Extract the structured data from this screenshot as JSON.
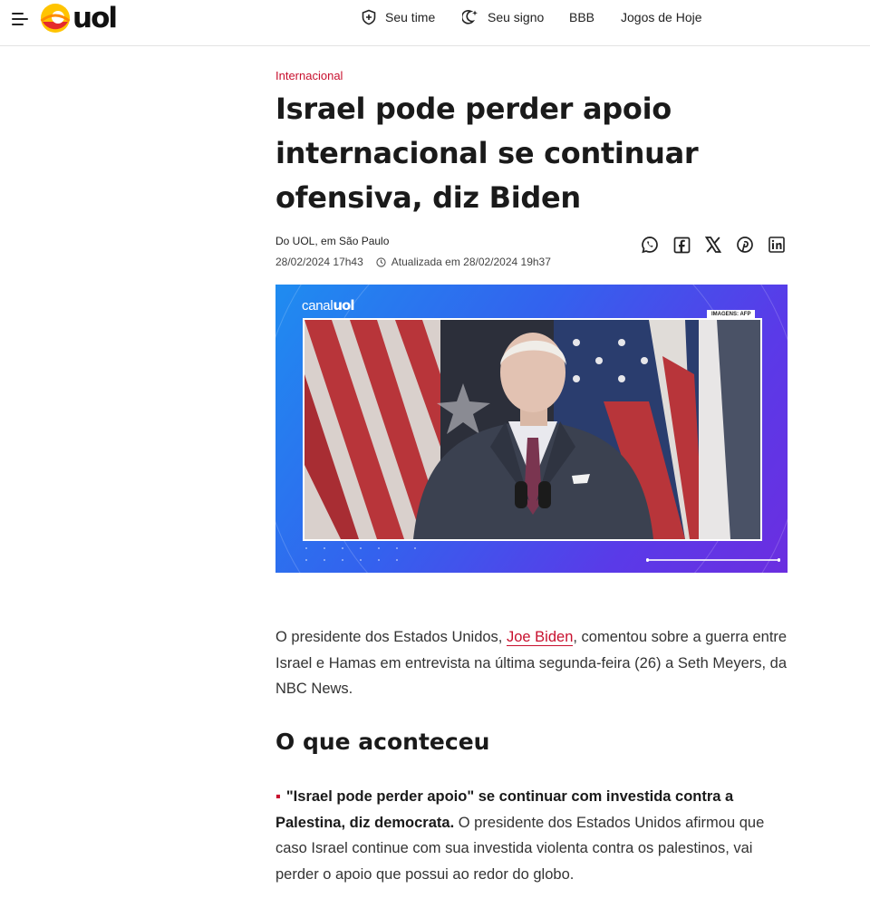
{
  "header": {
    "logo_text": "uol",
    "nav": [
      {
        "label": "Seu time",
        "icon": "shield-plus-icon"
      },
      {
        "label": "Seu signo",
        "icon": "moon-star-icon"
      },
      {
        "label": "BBB",
        "icon": ""
      },
      {
        "label": "Jogos de Hoje",
        "icon": ""
      }
    ]
  },
  "article": {
    "kicker": "Internacional",
    "title": "Israel pode perder apoio internacional se continuar ofensiva, diz Biden",
    "byline": "Do UOL, em São Paulo",
    "published": "28/02/2024 17h43",
    "updated": "Atualizada em 28/02/2024 19h37",
    "share": [
      "whatsapp-icon",
      "facebook-icon",
      "x-icon",
      "pinterest-icon",
      "linkedin-icon"
    ]
  },
  "video": {
    "brand_prefix": "canal",
    "brand_name": "uol",
    "credit": "IMAGENS: AFP"
  },
  "body": {
    "p1_before": "O presidente dos Estados Unidos, ",
    "p1_link": "Joe Biden",
    "p1_after": ", comentou sobre a guerra entre Israel e Hamas em entrevista na última segunda-feira (26) a Seth Meyers, da NBC News.",
    "h2": "O que aconteceu",
    "p2_bold": "\"Israel pode perder apoio\" se continuar com investida contra a Palestina, diz democrata.",
    "p2_text": " O presidente dos Estados Unidos afirmou que caso Israel continue com sua investida violenta contra os palestinos, vai perder o apoio que possui ao redor do globo."
  },
  "colors": {
    "accent": "#c8102e",
    "video_gradient_start": "#1f8cf0",
    "video_gradient_end": "#6b2ee0",
    "logo_yellow": "#ffc400",
    "logo_red": "#e52b2b"
  }
}
